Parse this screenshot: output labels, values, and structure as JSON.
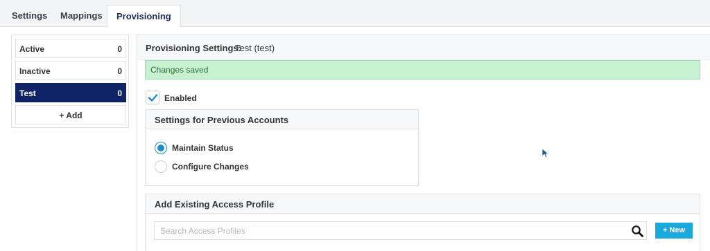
{
  "tabs": [
    {
      "label": "Settings",
      "active": false
    },
    {
      "label": "Mappings",
      "active": false
    },
    {
      "label": "Provisioning",
      "active": true
    }
  ],
  "sidebar": {
    "items": [
      {
        "label": "Active",
        "count": "0"
      },
      {
        "label": "Inactive",
        "count": "0"
      },
      {
        "label": "Test",
        "count": "0",
        "selected": true
      }
    ],
    "add_label": "+ Add"
  },
  "panel": {
    "title_prefix": "Provisioning Settings:",
    "title_value": "Test (test)",
    "alert": "Changes saved",
    "enabled_label": "Enabled",
    "enabled_checked": true,
    "previous_accounts": {
      "title": "Settings for Previous Accounts",
      "options": [
        {
          "label": "Maintain Status",
          "selected": true
        },
        {
          "label": "Configure Changes",
          "selected": false
        }
      ]
    },
    "access_profile": {
      "title": "Add Existing Access Profile",
      "search_placeholder": "Search Access Profiles",
      "search_value": "",
      "new_label": "+ New"
    }
  },
  "colors": {
    "selected_bg": "#0e2466",
    "accent": "#1f8ec3",
    "new_button": "#1ba8dd",
    "alert_bg": "#c8f1d1",
    "alert_text": "#2f6f3b"
  },
  "icons": [
    "check-icon",
    "search-icon",
    "mouse-cursor-icon"
  ]
}
